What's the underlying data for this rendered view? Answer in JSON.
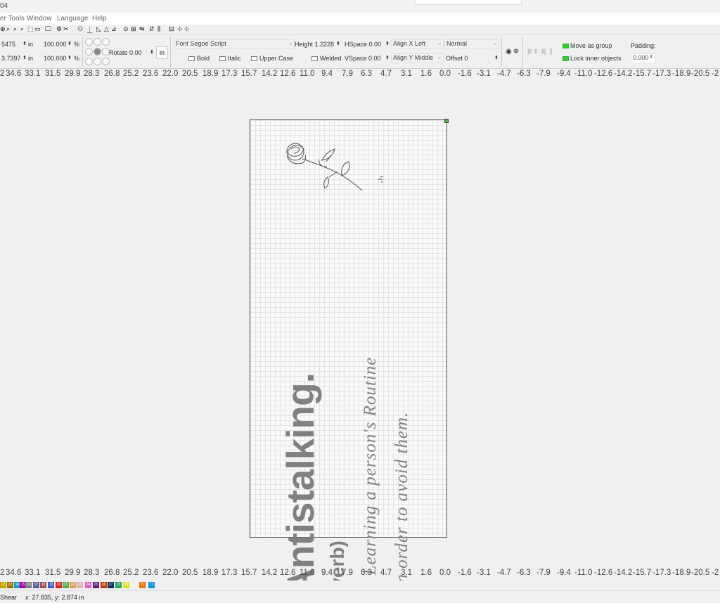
{
  "window": {
    "title_fragment": "04"
  },
  "menu": [
    "er Tools",
    "Window",
    "Language",
    "Help"
  ],
  "toolbar": {
    "width_value": "5475",
    "height_value": "3.7397",
    "unit1": "in",
    "unit2": "in",
    "scale_x": "100.000",
    "scale_y": "100.000",
    "pct1": "%",
    "pct2": "%",
    "rotate": "Rotate 0.00",
    "rotate_unit": "in",
    "font": "Font Segoe Script",
    "text_height": "Height 1.2228",
    "hspace": "HSpace 0.00",
    "vspace": "VSpace 0.00",
    "align_x": "Align X Left",
    "align_y": "Align Y Middle",
    "weight": "Normal",
    "offset": "Offset 0",
    "bold": "Bold",
    "italic": "Italic",
    "upper_case": "Upper Case",
    "welded": "Welded",
    "move_as_group": "Move as group",
    "lock_inner": "Lock inner objects",
    "padding_label": "Padding:",
    "padding_value": "0.000"
  },
  "ruler_ticks": [
    "2",
    "34.6",
    "33.1",
    "31.5",
    "29.9",
    "28.3",
    "26.8",
    "25.2",
    "23.6",
    "22.0",
    "20.5",
    "18.9",
    "17.3",
    "15.7",
    "14.2",
    "12.6",
    "11.0",
    "9.4",
    "7.9",
    "6.3",
    "4.7",
    "3.1",
    "1.6",
    "0.0",
    "-1.6",
    "-3.1",
    "-4.7",
    "-6.3",
    "-7.9",
    "-9.4",
    "-11.0",
    "-12.6",
    "-14.2",
    "-15.7",
    "-17.3",
    "-18.9",
    "-20.5",
    "-2"
  ],
  "design": {
    "title": "Antistalking.",
    "subtitle": "(verb)",
    "line1": "- Learning a person's Routine",
    "line2": "In order to avoid them."
  },
  "palette": [
    {
      "label": "02",
      "color": "#c8a000"
    },
    {
      "label": "03",
      "color": "#a07000"
    },
    {
      "label": "14",
      "color": "#10a0c0"
    },
    {
      "label": "15",
      "color": "#b000b0"
    },
    {
      "label": "16",
      "color": "#808080"
    },
    {
      "label": "17",
      "color": "#6060a0"
    },
    {
      "label": "18",
      "color": "#a05050"
    },
    {
      "label": "19",
      "color": "#4060c0"
    },
    {
      "label": "20",
      "color": "#e02020"
    },
    {
      "label": "21",
      "color": "#50b050"
    },
    {
      "label": "22",
      "color": "#e0a060"
    },
    {
      "label": "23",
      "color": "#e0b0b0"
    },
    {
      "label": "24",
      "color": "#e060c0"
    },
    {
      "label": "25",
      "color": "#602080"
    },
    {
      "label": "26",
      "color": "#c04000"
    },
    {
      "label": "27",
      "color": "#103060"
    },
    {
      "label": "28",
      "color": "#20a060"
    },
    {
      "label": "29",
      "color": "#e0e020"
    },
    {
      "label": "T1",
      "color": "#f07000"
    },
    {
      "label": "T2",
      "color": "#1090e0"
    }
  ],
  "status": {
    "mode": "Shear",
    "coords": "x: 27.835, y: 2.874 in"
  }
}
